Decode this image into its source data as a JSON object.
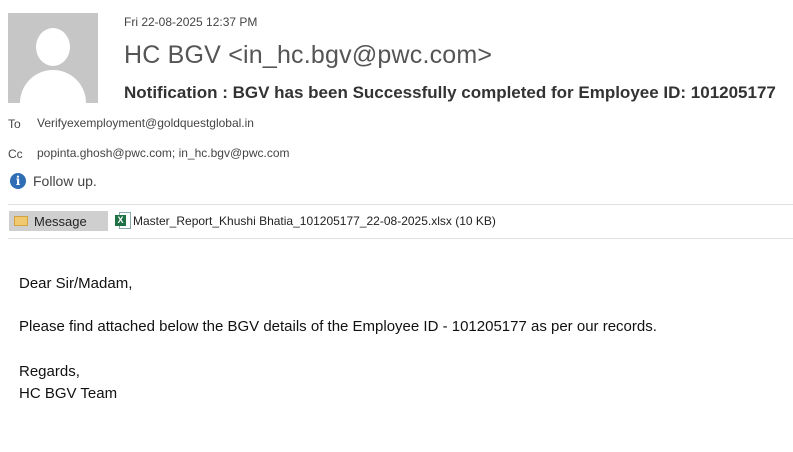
{
  "header": {
    "date": "Fri 22-08-2025 12:37 PM",
    "sender": "HC BGV <in_hc.bgv@pwc.com>",
    "subject": "Notification : BGV has been Successfully completed for  Employee ID: 101205177"
  },
  "recipients": {
    "to_label": "To",
    "to_value": "Verifyexemployment@goldquestglobal.in",
    "cc_label": "Cc",
    "cc_value": "popinta.ghosh@pwc.com; in_hc.bgv@pwc.com"
  },
  "flag": {
    "text": "Follow up.",
    "icon": "info-icon"
  },
  "tabs": {
    "message_label": "Message",
    "attachment_label": "Master_Report_Khushi Bhatia_101205177_22-08-2025.xlsx (10 KB)"
  },
  "body": {
    "greeting": "Dear Sir/Madam,",
    "line1": "Please find attached below the BGV details of the Employee ID - 101205177 as per our records.",
    "closing": "Regards,",
    "signature": "HC BGV Team"
  },
  "colors": {
    "avatar_bg": "#c6c6c6",
    "tab_bg": "#cfcfcf",
    "info_blue": "#2f6db5",
    "excel_green": "#1e7145"
  }
}
